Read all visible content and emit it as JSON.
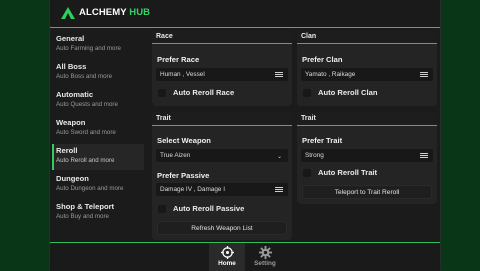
{
  "app": {
    "title_main": "ALCHEMY ",
    "title_accent": "HUB"
  },
  "sidebar": {
    "items": [
      {
        "label": "General",
        "sub": "Auto Farming and more"
      },
      {
        "label": "All Boss",
        "sub": "Auto Boss and more"
      },
      {
        "label": "Automatic",
        "sub": "Auto Quests and more"
      },
      {
        "label": "Weapon",
        "sub": "Auto Sword and more"
      },
      {
        "label": "Reroll",
        "sub": "Auto Reroll and more",
        "active": true
      },
      {
        "label": "Dungeon",
        "sub": "Auto Dungeon and more"
      },
      {
        "label": "Shop & Teleport",
        "sub": "Auto Buy and more"
      }
    ]
  },
  "race": {
    "header": "Race",
    "prefer_label": "Prefer Race",
    "prefer_value": "Human , Vessel",
    "auto_reroll": "Auto Reroll Race"
  },
  "clan": {
    "header": "Clan",
    "prefer_label": "Prefer Clan",
    "prefer_value": "Yamato , Raikage",
    "auto_reroll": "Auto Reroll Clan"
  },
  "trait_left": {
    "header": "Trait",
    "select_label": "Select Weapon",
    "select_value": "True Aizen",
    "passive_label": "Prefer Passive",
    "passive_value": "Damage IV , Damage I",
    "auto_reroll": "Auto Reroll Passive",
    "refresh": "Refresh Weapon List"
  },
  "trait_right": {
    "header": "Trait",
    "prefer_label": "Prefer Trait",
    "prefer_value": "Strong",
    "auto_reroll": "Auto Reroll Trait",
    "teleport": "Teleport to Trait Reroll"
  },
  "bottom_nav": {
    "home": "Home",
    "setting": "Setting"
  },
  "colors": {
    "accent": "#2fbf5a",
    "background": "#0a3618"
  }
}
